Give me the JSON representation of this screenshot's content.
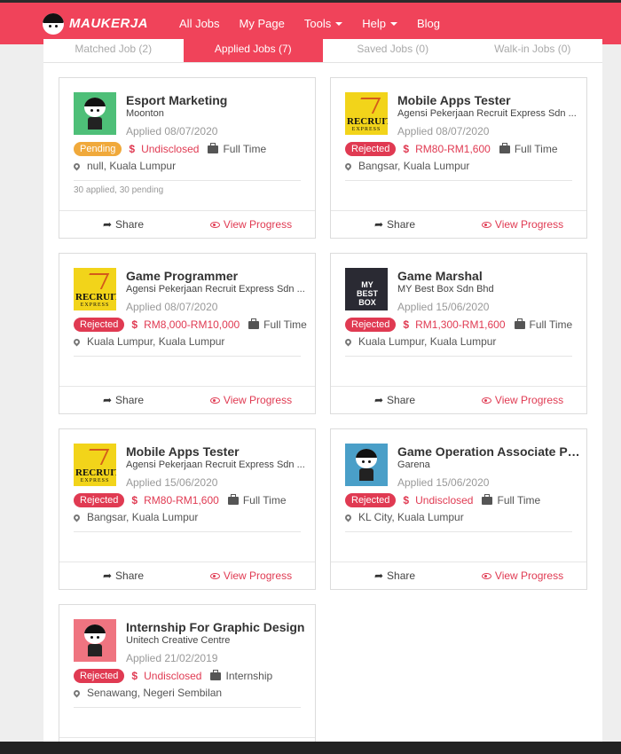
{
  "nav": {
    "brand": "MAUKERJA",
    "items": [
      {
        "label": "All Jobs",
        "dropdown": false
      },
      {
        "label": "My Page",
        "dropdown": false
      },
      {
        "label": "Tools",
        "dropdown": true
      },
      {
        "label": "Help",
        "dropdown": true
      },
      {
        "label": "Blog",
        "dropdown": false
      }
    ]
  },
  "tabs": [
    {
      "label": "Matched Job (2)",
      "active": false
    },
    {
      "label": "Applied Jobs (7)",
      "active": true
    },
    {
      "label": "Saved Jobs (0)",
      "active": false
    },
    {
      "label": "Walk-in Jobs (0)",
      "active": false
    }
  ],
  "actions": {
    "share": "Share",
    "view_progress": "View Progress"
  },
  "colors": {
    "brand": "#f0435a",
    "pending": "#f0a93b",
    "rejected": "#e03a52"
  },
  "jobs": [
    {
      "title": "Esport Marketing",
      "company": "Moonton",
      "applied": "Applied 08/07/2020",
      "status": "Pending",
      "salary": "Undisclosed",
      "type": "Full Time",
      "location": "null, Kuala Lumpur",
      "counts": "30 applied, 30 pending",
      "logo": "mascot-green"
    },
    {
      "title": "Mobile Apps Tester",
      "company": "Agensi Pekerjaan Recruit Express Sdn ...",
      "applied": "Applied 08/07/2020",
      "status": "Rejected",
      "salary": "RM80-RM1,600",
      "type": "Full Time",
      "location": "Bangsar, Kuala Lumpur",
      "counts": "",
      "logo": "recruit"
    },
    {
      "title": "Game Programmer",
      "company": "Agensi Pekerjaan Recruit Express Sdn ...",
      "applied": "Applied 08/07/2020",
      "status": "Rejected",
      "salary": "RM8,000-RM10,000",
      "type": "Full Time",
      "location": "Kuala Lumpur, Kuala Lumpur",
      "counts": "",
      "logo": "recruit"
    },
    {
      "title": "Game Marshal",
      "company": "MY Best Box Sdn Bhd",
      "applied": "Applied 15/06/2020",
      "status": "Rejected",
      "salary": "RM1,300-RM1,600",
      "type": "Full Time",
      "location": "Kuala Lumpur, Kuala Lumpur",
      "counts": "",
      "logo": "bestbox"
    },
    {
      "title": "Mobile Apps Tester",
      "company": "Agensi Pekerjaan Recruit Express Sdn ...",
      "applied": "Applied 15/06/2020",
      "status": "Rejected",
      "salary": "RM80-RM1,600",
      "type": "Full Time",
      "location": "Bangsar, Kuala Lumpur",
      "counts": "",
      "logo": "recruit"
    },
    {
      "title": "Game Operation Associate Pro...",
      "company": "Garena",
      "applied": "Applied 15/06/2020",
      "status": "Rejected",
      "salary": "Undisclosed",
      "type": "Full Time",
      "location": "KL City, Kuala Lumpur",
      "counts": "",
      "logo": "mascot-teal"
    },
    {
      "title": "Internship For Graphic Design",
      "company": "Unitech Creative Centre",
      "applied": "Applied 21/02/2019",
      "status": "Rejected",
      "salary": "Undisclosed",
      "type": "Internship",
      "location": "Senawang, Negeri Sembilan",
      "counts": "",
      "logo": "mascot-pink"
    }
  ],
  "logo_text": {
    "recruit": "RECRUIT",
    "recruit_sub": "EXPRESS",
    "bestbox": "MY BEST BOX"
  }
}
